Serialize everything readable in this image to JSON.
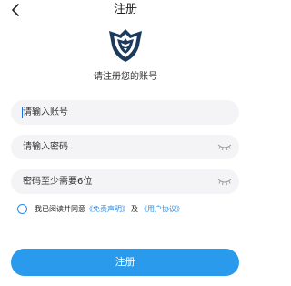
{
  "header": {
    "title": "注册",
    "back_icon": "chevron-left-icon"
  },
  "logo": {
    "icon": "eagle-shield-logo",
    "color": "#1c3a5e"
  },
  "subtitle": "请注册您的账号",
  "form": {
    "account": {
      "placeholder": "请输入账号",
      "value": ""
    },
    "password": {
      "placeholder": "请输入密码",
      "value": "",
      "toggle_icon": "eye-closed-icon"
    },
    "confirm": {
      "placeholder": "密码至少需要6位",
      "value": "",
      "toggle_icon": "eye-closed-icon"
    }
  },
  "agreement": {
    "prefix": "我已阅读并同意",
    "disclaimer_link": "《免责声明》",
    "conjunction": "及",
    "user_agreement_link": "《用户协议》",
    "checked": false
  },
  "register_button": "注册",
  "colors": {
    "accent": "#2a9bec",
    "link": "#2a8be8",
    "field_bg": "#f4f4f6"
  }
}
